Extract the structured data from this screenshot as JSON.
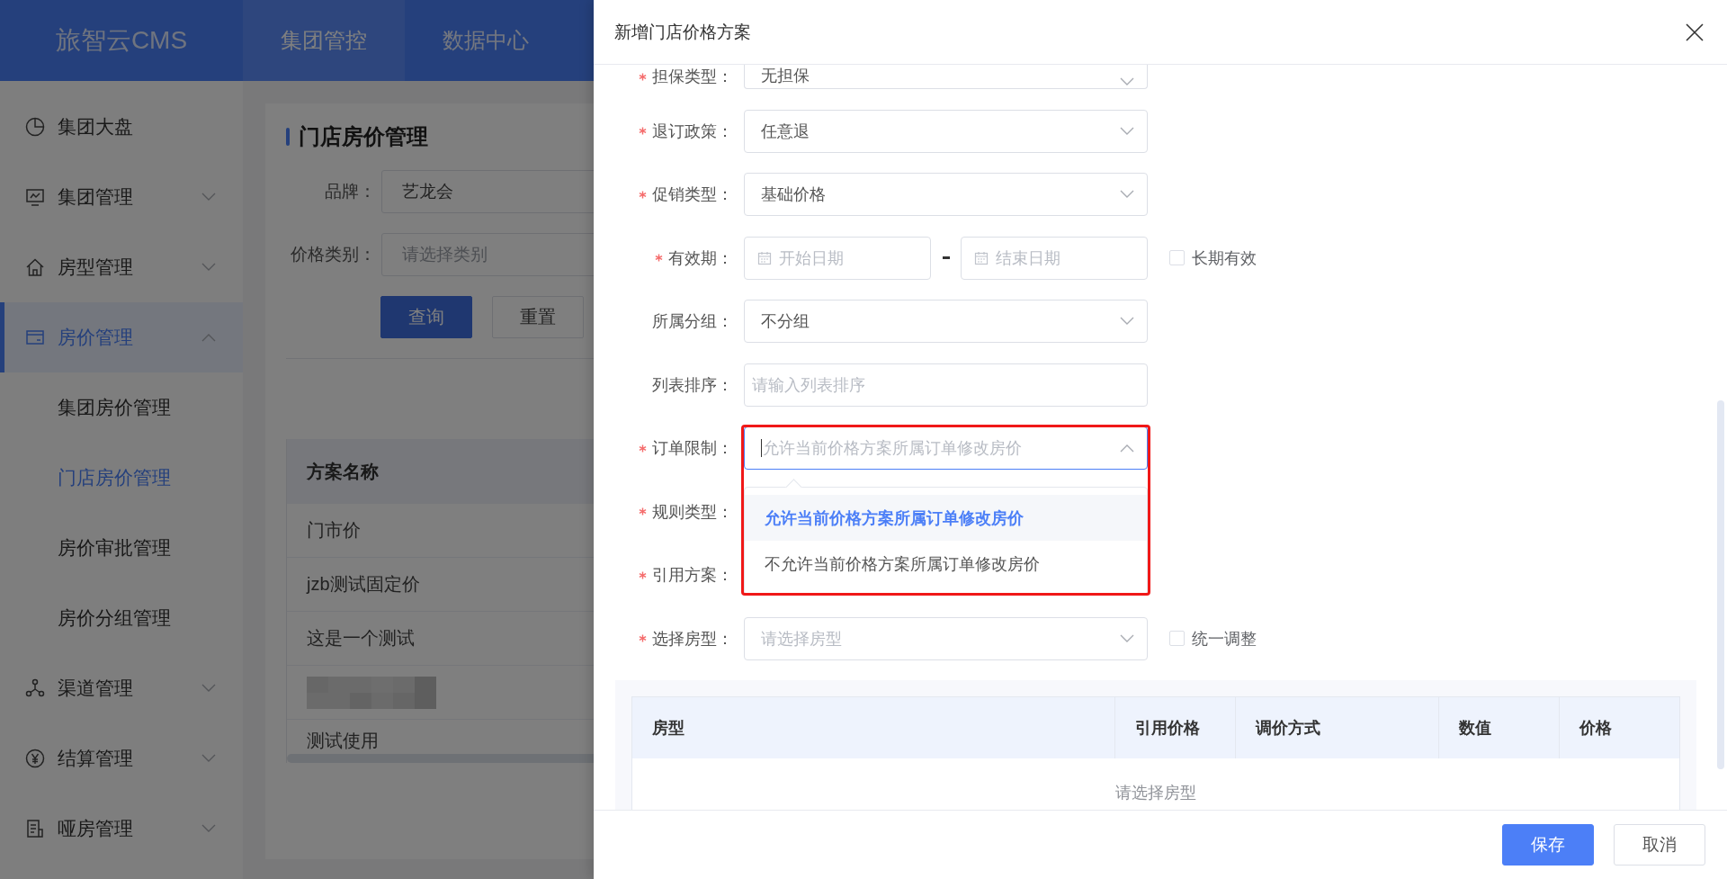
{
  "header": {
    "logo": "旅智云CMS",
    "nav": [
      {
        "label": "集团管控",
        "selected": true
      },
      {
        "label": "数据中心",
        "selected": false
      }
    ]
  },
  "sidebar": {
    "items": [
      {
        "label": "集团大盘",
        "kind": "link",
        "selected": false
      },
      {
        "label": "集团管理",
        "kind": "group",
        "expanded": false,
        "selected": false
      },
      {
        "label": "房型管理",
        "kind": "group",
        "expanded": false,
        "selected": false
      },
      {
        "label": "房价管理",
        "kind": "group",
        "expanded": true,
        "selected": true,
        "children": [
          {
            "label": "集团房价管理",
            "selected": false
          },
          {
            "label": "门店房价管理",
            "selected": true
          },
          {
            "label": "房价审批管理",
            "selected": false
          },
          {
            "label": "房价分组管理",
            "selected": false
          }
        ]
      },
      {
        "label": "渠道管理",
        "kind": "group",
        "expanded": false,
        "selected": false
      },
      {
        "label": "结算管理",
        "kind": "group",
        "expanded": false,
        "selected": false
      },
      {
        "label": "哑房管理",
        "kind": "group",
        "expanded": false,
        "selected": false
      }
    ]
  },
  "page": {
    "title": "门店房价管理",
    "filters": [
      {
        "label": "品牌：",
        "value": "艺龙会"
      },
      {
        "label": "价格类别：",
        "placeholder": "请选择类别"
      }
    ],
    "buttons": [
      {
        "label": "查询",
        "kind": "primary"
      },
      {
        "label": "重置",
        "kind": "default"
      }
    ],
    "table": {
      "columns": [
        "方案名称"
      ],
      "rows": [
        {
          "kind": "text",
          "cell": "门市价"
        },
        {
          "kind": "text",
          "cell": "jzb测试固定价"
        },
        {
          "kind": "text",
          "cell": "这是一个测试"
        },
        {
          "kind": "blurred"
        },
        {
          "kind": "text",
          "cell": "测试使用"
        }
      ]
    }
  },
  "drawer": {
    "title": "新增门店价格方案",
    "form": [
      {
        "label": "担保类型：",
        "required": true,
        "kind": "select",
        "value": "无担保"
      },
      {
        "label": "退订政策：",
        "required": true,
        "kind": "select",
        "value": "任意退"
      },
      {
        "label": "促销类型：",
        "required": true,
        "kind": "select",
        "value": "基础价格"
      },
      {
        "label": "有效期：",
        "required": true,
        "kind": "daterange",
        "start_placeholder": "开始日期",
        "end_placeholder": "结束日期",
        "checkbox": {
          "label": "长期有效",
          "checked": false
        }
      },
      {
        "label": "所属分组：",
        "required": false,
        "kind": "select",
        "value": "不分组"
      },
      {
        "label": "列表排序：",
        "required": false,
        "kind": "input",
        "placeholder": "请输入列表排序"
      },
      {
        "label": "订单限制：",
        "required": true,
        "kind": "select",
        "placeholder": "允许当前价格方案所属订单修改房价",
        "expanded": true,
        "options": [
          {
            "label": "允许当前价格方案所属订单修改房价",
            "selected": true
          },
          {
            "label": "不允许当前价格方案所属订单修改房价",
            "selected": false
          }
        ]
      },
      {
        "label": "规则类型：",
        "required": true,
        "kind": "covered"
      },
      {
        "label": "引用方案：",
        "required": true,
        "kind": "covered"
      },
      {
        "label": "选择房型：",
        "required": true,
        "kind": "select",
        "placeholder": "请选择房型",
        "checkbox": {
          "label": "统一调整",
          "checked": false
        }
      }
    ],
    "table": {
      "columns": [
        "房型",
        "引用价格",
        "调价方式",
        "数值",
        "价格"
      ],
      "empty_text": "请选择房型"
    },
    "buttons": [
      {
        "label": "保存",
        "kind": "primary"
      },
      {
        "label": "取消",
        "kind": "default"
      }
    ]
  }
}
